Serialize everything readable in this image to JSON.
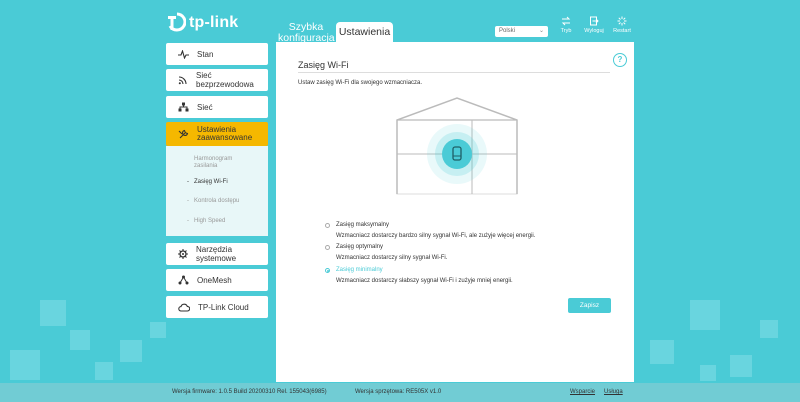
{
  "brand": {
    "logo_text": "tp-link",
    "accent": "#4acbd6",
    "active": "#f5b800"
  },
  "header": {
    "tabs": [
      {
        "label_line1": "Szybka",
        "label_line2": "konfiguracja"
      },
      {
        "label": "Ustawienia"
      }
    ],
    "language": "Polski",
    "buttons": [
      {
        "label": "Tryb",
        "icon": "mode-swap-icon"
      },
      {
        "label": "Wyloguj",
        "icon": "logout-icon"
      },
      {
        "label": "Restart",
        "icon": "restart-icon"
      }
    ]
  },
  "sidebar": {
    "items": [
      {
        "label": "Stan",
        "icon": "pulse-icon"
      },
      {
        "label": "Sieć bezprzewodowa",
        "icon": "wifi-icon"
      },
      {
        "label": "Sieć",
        "icon": "network-icon"
      },
      {
        "label_line1": "Ustawienia",
        "label_line2": "zaawansowane",
        "icon": "tools-icon",
        "active": true
      },
      {
        "label": "Narzędzia systemowe",
        "icon": "gear-icon"
      },
      {
        "label": "OneMesh",
        "icon": "mesh-icon"
      },
      {
        "label": "TP-Link Cloud",
        "icon": "cloud-icon"
      }
    ],
    "sub_items": [
      {
        "label_line1": "Harmonogram",
        "label_line2": "zasilania"
      },
      {
        "label": "Zasięg Wi-Fi",
        "current": true
      },
      {
        "label": "Kontrola dostępu"
      },
      {
        "label": "High Speed"
      }
    ]
  },
  "main": {
    "title": "Zasięg Wi-Fi",
    "description": "Ustaw zasięg Wi-Fi dla swojego wzmacniacza.",
    "options": [
      {
        "label": "Zasięg maksymalny",
        "desc": "Wzmacniacz dostarczy bardzo silny sygnał Wi-Fi, ale zużyje więcej energii.",
        "selected": false
      },
      {
        "label": "Zasięg optymalny",
        "desc": "Wzmacniacz dostarczy silny sygnał Wi-Fi.",
        "selected": false
      },
      {
        "label": "Zasięg minimalny",
        "desc": "Wzmacniacz dostarczy słabszy sygnał Wi-Fi i zużyje mniej energii.",
        "selected": true
      }
    ],
    "save_label": "Zapisz"
  },
  "footer": {
    "firmware": "Wersja firmware: 1.0.5 Build 20200310 Rel. 155043(6985)",
    "hardware": "Wersja sprzętowa: RE505X v1.0",
    "support": "Wsparcie",
    "service": "Usługa"
  }
}
